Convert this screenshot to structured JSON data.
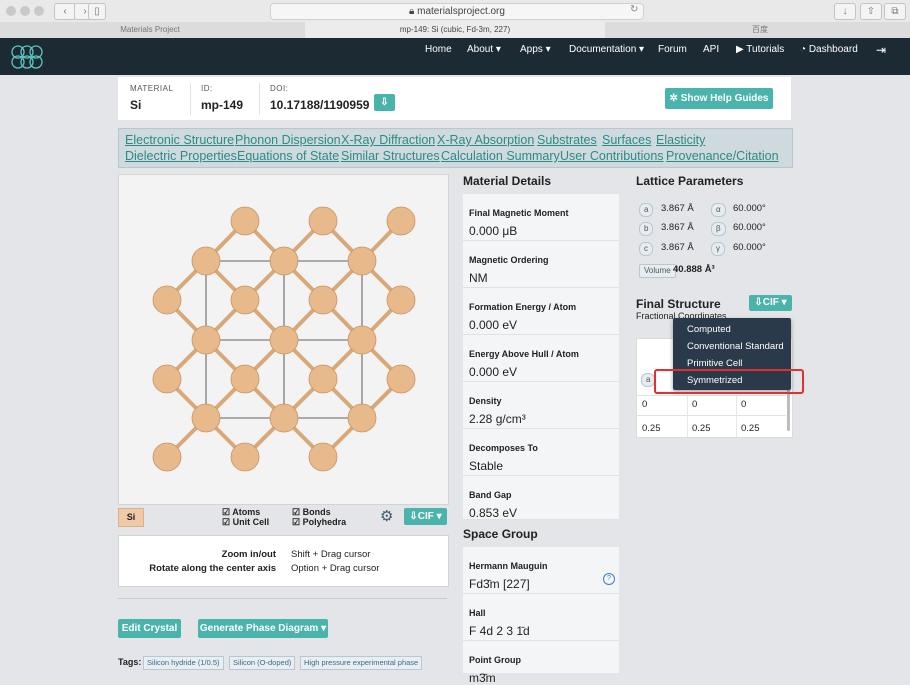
{
  "browser": {
    "url": "materialsproject.org",
    "tabs": [
      "Materials Project",
      "mp-149: Si (cubic, Fd-3m, 227)",
      "百度"
    ]
  },
  "nav": {
    "items": [
      "Home",
      "About ▾",
      "Apps ▾",
      "Documentation ▾",
      "Forum",
      "API",
      "Tutorials",
      "Dashboard"
    ]
  },
  "header": {
    "material_label": "MATERIAL",
    "material": "Si",
    "id_label": "ID:",
    "id": "mp-149",
    "doi_label": "DOI:",
    "doi": "10.17188/1190959",
    "help_button": "Show Help Guides"
  },
  "tabs_row1": [
    "Electronic Structure",
    "Phonon Dispersion",
    "X-Ray Diffraction",
    "X-Ray Absorption",
    "Substrates",
    "Surfaces",
    "Elasticity"
  ],
  "tabs_row2": [
    "Dielectric Properties",
    "Equations of State",
    "Similar Structures",
    "Calculation Summary",
    "User Contributions",
    "Provenance/Citation"
  ],
  "viewer": {
    "element_badge": "Si",
    "opts": [
      "Atoms",
      "Unit Cell",
      "Bonds",
      "Polyhedra"
    ],
    "cif_button": "CIF ▾",
    "help_rows": [
      {
        "action": "Zoom in/out",
        "key": "Shift + Drag cursor"
      },
      {
        "action": "Rotate along the center axis",
        "key": "Option + Drag cursor"
      }
    ]
  },
  "details": {
    "title": "Material Details",
    "rows": [
      {
        "label": "Final Magnetic Moment",
        "value": "0.000 μB"
      },
      {
        "label": "Magnetic Ordering",
        "value": "NM"
      },
      {
        "label": "Formation Energy / Atom",
        "value": "0.000 eV"
      },
      {
        "label": "Energy Above Hull / Atom",
        "value": "0.000 eV"
      },
      {
        "label": "Density",
        "value": "2.28 g/cm³"
      },
      {
        "label": "Decomposes To",
        "value": "Stable"
      },
      {
        "label": "Band Gap",
        "value": "0.853 eV"
      }
    ]
  },
  "spacegroup": {
    "title": "Space Group",
    "rows": [
      {
        "label": "Hermann Mauguin",
        "value": "Fd3̄m [227]"
      },
      {
        "label": "Hall",
        "value": "F 4d 2 3 1̄d"
      },
      {
        "label": "Point Group",
        "value": "m3̄m"
      }
    ]
  },
  "lattice": {
    "title": "Lattice Parameters",
    "params": [
      {
        "k": "a",
        "v": "3.867 Å",
        "ak": "α",
        "av": "60.000°"
      },
      {
        "k": "b",
        "v": "3.867 Å",
        "ak": "β",
        "av": "60.000°"
      },
      {
        "k": "c",
        "v": "3.867 Å",
        "ak": "γ",
        "av": "60.000°"
      }
    ],
    "volume_label": "Volume",
    "volume": "40.888 Å³"
  },
  "structure": {
    "title": "Final Structure",
    "subtitle": "Fractional Coordinates",
    "cif_button": "CIF ▾",
    "menu": [
      "Computed",
      "Conventional Standard",
      "Primitive Cell",
      "Symmetrized"
    ],
    "col_a": "a",
    "rows": [
      [
        "0",
        "0",
        "0"
      ],
      [
        "0.25",
        "0.25",
        "0.25"
      ]
    ]
  },
  "actions": {
    "edit": "Edit Crystal",
    "phase": "Generate Phase Diagram ▾"
  },
  "tags": {
    "label": "Tags:",
    "items": [
      "Silicon hydride (1/0.5)",
      "Silicon (O-doped)",
      "High pressure experimental phase"
    ]
  },
  "colors": {
    "accent": "#4ab3ac",
    "nav_bg": "#1c2a33",
    "menu_bg": "#2a3a4a",
    "highlight": "#e03030",
    "atom": "#e8b98a"
  }
}
